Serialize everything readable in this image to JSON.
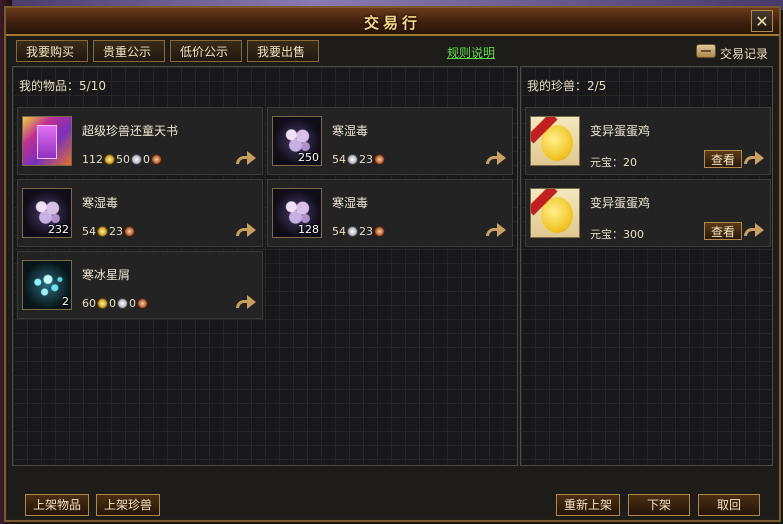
{
  "window": {
    "title": "交易行",
    "close_label": "✕"
  },
  "tabs": [
    "我要购买",
    "贵重公示",
    "低价公示",
    "我要出售"
  ],
  "rules_link": "规则说明",
  "history_label": "交易记录",
  "my_items": {
    "header": "我的物品：5/10",
    "items": [
      {
        "name": "超级珍兽还童天书",
        "icon": "book-icon",
        "count": "",
        "gold": "112",
        "silver": "50",
        "copper": "0"
      },
      {
        "name": "寒湿毒",
        "icon": "poison-icon",
        "count": "250",
        "gold": "",
        "silver": "54",
        "copper": "23"
      },
      {
        "name": "寒湿毒",
        "icon": "poison-icon",
        "count": "232",
        "gold": "54",
        "silver": "",
        "copper": "23"
      },
      {
        "name": "寒湿毒",
        "icon": "poison-icon",
        "count": "128",
        "gold": "",
        "silver": "54",
        "copper": "23"
      },
      {
        "name": "寒冰星屑",
        "icon": "ice-shard-icon",
        "count": "2",
        "gold": "60",
        "silver": "0",
        "copper": "0"
      }
    ]
  },
  "my_pets": {
    "header": "我的珍兽：2/5",
    "pets": [
      {
        "name": "变异蛋蛋鸡",
        "icon": "chick-icon",
        "price": "元宝：20",
        "view_label": "查看"
      },
      {
        "name": "变异蛋蛋鸡",
        "icon": "chick-icon",
        "price": "元宝：300",
        "view_label": "查看"
      }
    ]
  },
  "footer": {
    "list_item": "上架物品",
    "list_pet": "上架珍兽",
    "relist": "重新上架",
    "delist": "下架",
    "cancel": "取回"
  }
}
